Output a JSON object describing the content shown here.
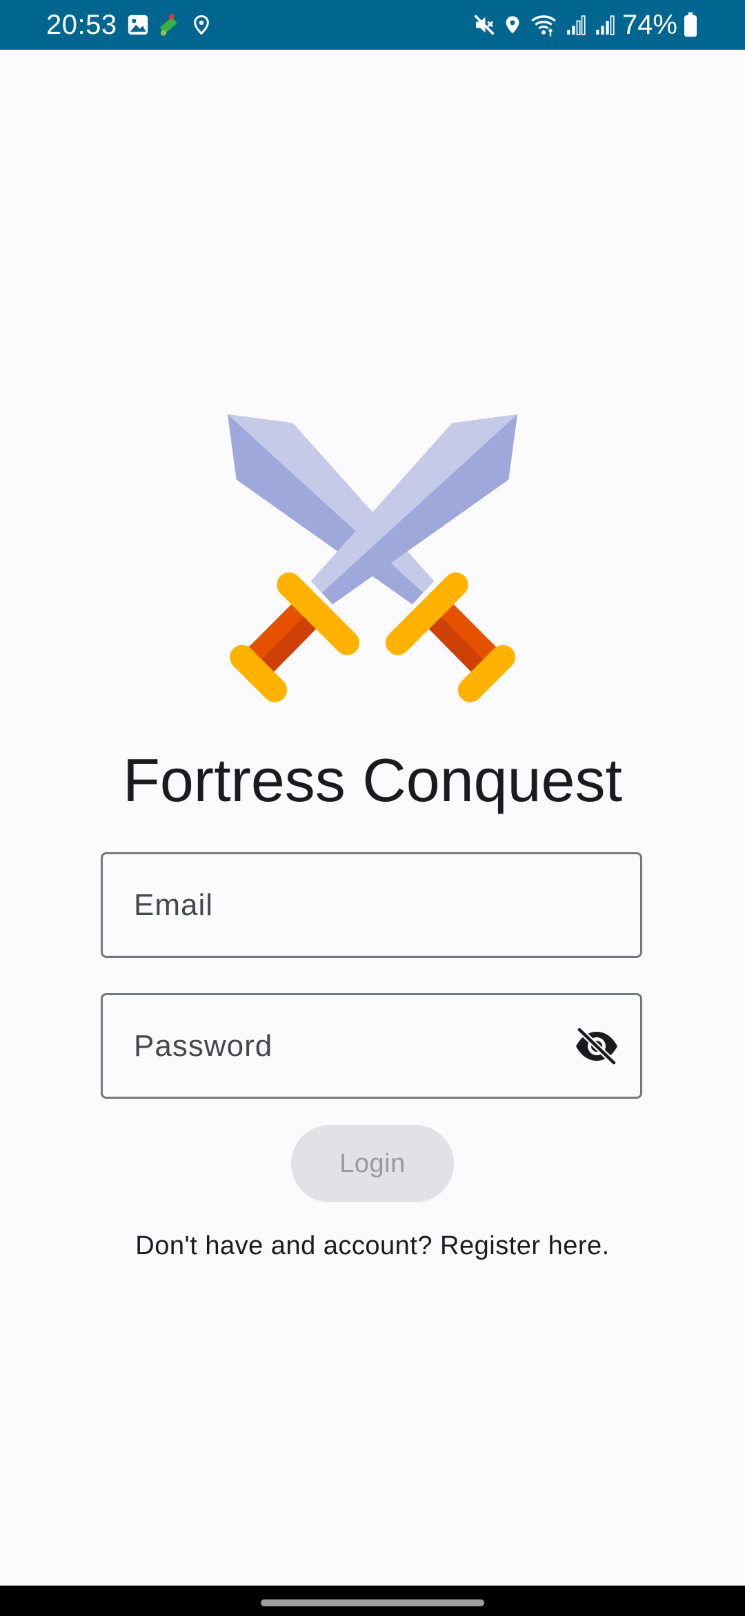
{
  "status_bar": {
    "time": "20:53",
    "battery": "74%",
    "left_icons": [
      "gallery-icon",
      "app-notification-icon",
      "location-icon"
    ],
    "right_icons": [
      "mute-icon",
      "location-icon",
      "wifi-icon",
      "signal-icon",
      "signal-icon",
      "battery-icon"
    ],
    "background": "#00668f"
  },
  "app": {
    "logo": "crossed-swords-icon",
    "title": "Fortress Conquest"
  },
  "form": {
    "email_placeholder": "Email",
    "password_placeholder": "Password",
    "password_toggle": "visibility-off-icon",
    "login_label": "Login",
    "register_text": "Don't have and account? Register here."
  },
  "colors": {
    "background": "#fbfbfe",
    "login_button_disabled": "#e2e2e6",
    "field_border": "#74777f"
  }
}
